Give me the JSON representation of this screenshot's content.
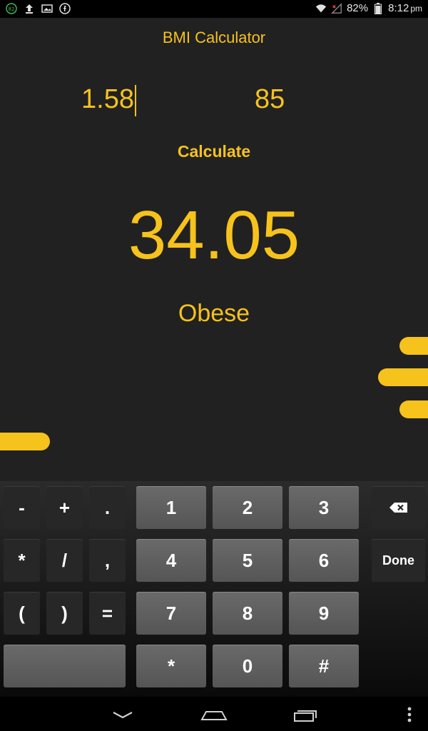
{
  "status_bar": {
    "notif_badge": "82",
    "battery_percent": "82%",
    "time": "8:12",
    "time_suffix": "pm",
    "left_icons": [
      "badge-icon",
      "upload-icon",
      "image-icon",
      "facebook-icon"
    ],
    "right_icons": [
      "wifi-icon",
      "signal-icon",
      "battery-icon"
    ]
  },
  "app": {
    "title": "BMI Calculator",
    "height_value": "1.58",
    "weight_value": "85",
    "calculate_label": "Calculate",
    "bmi_value": "34.05",
    "bmi_status": "Obese",
    "accent_color": "#f6c21c",
    "background_color": "#212121"
  },
  "keyboard": {
    "row1": [
      "-",
      "+",
      ".",
      "1",
      "2",
      "3",
      "backspace"
    ],
    "row2": [
      "*",
      "/",
      ",",
      "4",
      "5",
      "6",
      "Done"
    ],
    "row3": [
      "(",
      ")",
      "=",
      "7",
      "8",
      "9"
    ],
    "row4": [
      "space",
      "*",
      "0",
      "#"
    ],
    "labels": {
      "minus": "-",
      "plus": "+",
      "dot": ".",
      "k1": "1",
      "k2": "2",
      "k3": "3",
      "star": "*",
      "slash": "/",
      "comma": ",",
      "k4": "4",
      "k5": "5",
      "k6": "6",
      "done": "Done",
      "lparen": "(",
      "rparen": ")",
      "equals": "=",
      "k7": "7",
      "k8": "8",
      "k9": "9",
      "star2": "*",
      "k0": "0",
      "hash": "#"
    }
  },
  "nav_bar": {
    "icons": [
      "back-icon",
      "home-icon",
      "recent-apps-icon",
      "menu-icon"
    ]
  }
}
